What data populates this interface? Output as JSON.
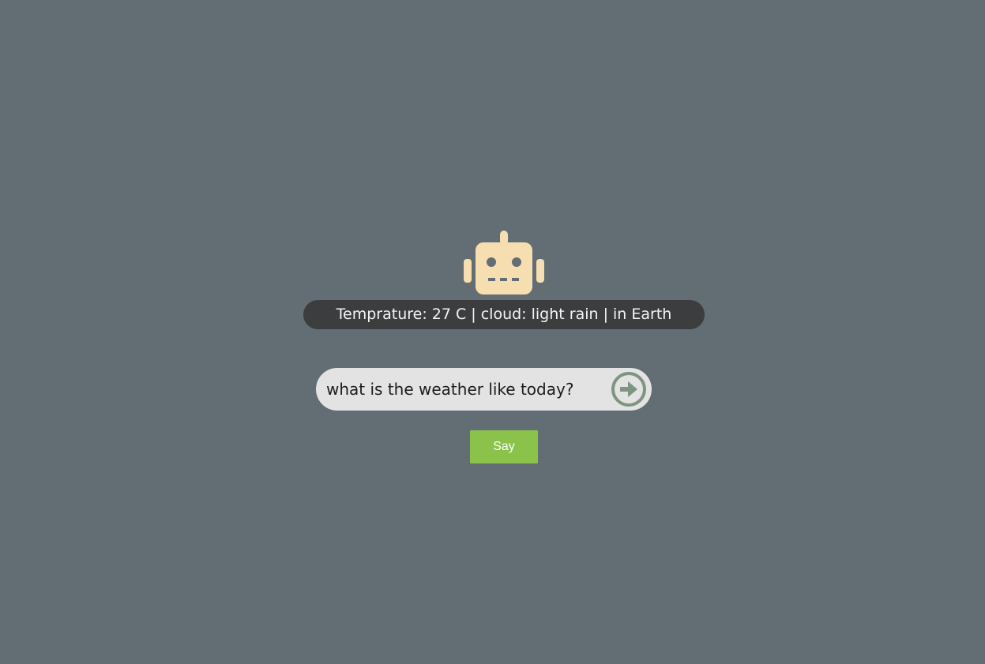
{
  "colors": {
    "background": "#636e74",
    "robot": "#f6deb1",
    "response_bar": "#3c3d3f",
    "input_bg": "#e3e3e3",
    "send_icon": "#7d9581",
    "say_button": "#8bc34a"
  },
  "header": {
    "icon": "robot-icon"
  },
  "response": {
    "text": "Temprature: 27 C | cloud: light rain | in Earth"
  },
  "query": {
    "value": "what is the weather like today?",
    "send_icon": "arrow-right-circle-icon"
  },
  "actions": {
    "say_label": "Say"
  }
}
